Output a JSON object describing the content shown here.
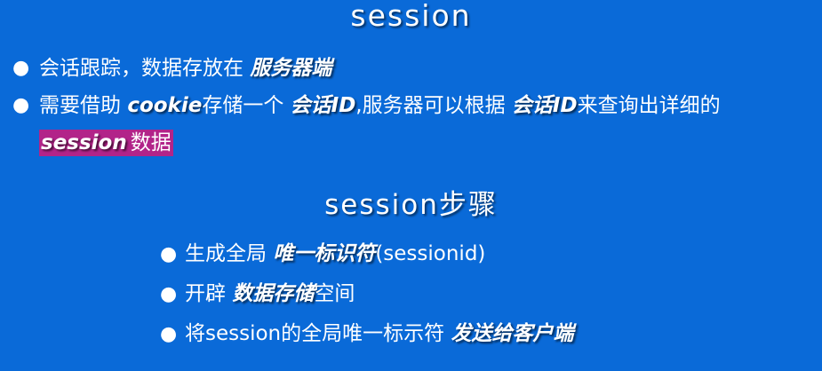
{
  "title": "session",
  "bullets": [
    {
      "text1": "会话跟踪，数据存放在 ",
      "em1": "服务器端"
    },
    {
      "text1": "需要借助 ",
      "em1": "cookie",
      "text2": "存储一个 ",
      "em2": "会话ID",
      "text3": ",服务器可以根据 ",
      "em3": "会话ID",
      "text4": "来查询出详细的 ",
      "em4": "session",
      "text5": "数据"
    }
  ],
  "steps_title": "session步骤",
  "steps": [
    {
      "text1": "生成全局 ",
      "em1": "唯一标识符",
      "text2": "(sessionid)"
    },
    {
      "text1": "开辟 ",
      "em1": "数据存储",
      "text2": "空间"
    },
    {
      "text1": "将session的全局唯一标示符 ",
      "em1": "发送给客户端"
    }
  ],
  "colors": {
    "background": "#0a6ad8",
    "highlight": "#b22489",
    "text": "#ffffff"
  }
}
